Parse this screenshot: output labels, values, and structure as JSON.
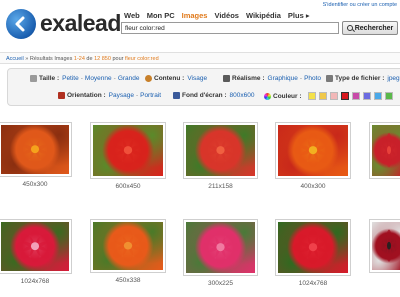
{
  "header": {
    "logo_text": "exalead",
    "nav": [
      {
        "label": "Web",
        "active": false
      },
      {
        "label": "Mon PC",
        "active": false
      },
      {
        "label": "Images",
        "active": true
      },
      {
        "label": "Vidéos",
        "active": false
      },
      {
        "label": "Wikipédia",
        "active": false
      },
      {
        "label": "Plus ▸",
        "active": false
      }
    ],
    "top_links": "S'identifier ou créer un compte",
    "search_value": "fleur color:red",
    "search_button": "Rechercher"
  },
  "breadcrumb": {
    "home": "Accueil",
    "sep": " » ",
    "results_label": "Résultats Images ",
    "range": "1-24",
    "of": " de ",
    "total": "12 850",
    "for": " pour ",
    "query": "fleur color:red"
  },
  "filters": {
    "taille": {
      "label": "Taille :",
      "options": [
        "Petite",
        "Moyenne",
        "Grande"
      ]
    },
    "contenu": {
      "label": "Contenu :",
      "options": [
        "Visage"
      ]
    },
    "realisme": {
      "label": "Réalisme :",
      "options": [
        "Graphique",
        "Photo"
      ]
    },
    "type": {
      "label": "Type de fichier :",
      "options": [
        "jpeg"
      ]
    },
    "orientation": {
      "label": "Orientation :",
      "options": [
        "Paysage",
        "Portrait"
      ]
    },
    "fond": {
      "label": "Fond d'écran :",
      "options": [
        "800x600"
      ]
    },
    "couleur": {
      "label": "Couleur :",
      "swatches": [
        "#f4e14a",
        "#f0c84a",
        "#f2b8b8",
        "#d8181e",
        "#c84aa8",
        "#6a6ae0",
        "#4aa8e8",
        "#5ab84a"
      ]
    }
  },
  "results": [
    {
      "size": "450x300",
      "colors": [
        "#e0581a",
        "#f5a21c",
        "#8a2e10"
      ]
    },
    {
      "size": "600x450",
      "colors": [
        "#d8231c",
        "#f0503a",
        "#5a8a2a"
      ]
    },
    {
      "size": "211x158",
      "colors": [
        "#d8352a",
        "#f06040",
        "#3f7a28"
      ]
    },
    {
      "size": "400x300",
      "colors": [
        "#e85a14",
        "#f2b020",
        "#c8281a"
      ]
    },
    {
      "size": "",
      "colors": [
        "#c8202a",
        "#e8403a",
        "#6a8a30"
      ]
    },
    {
      "size": "1024x768",
      "colors": [
        "#d81a3a",
        "#f2a0b8",
        "#3a6a20"
      ]
    },
    {
      "size": "450x338",
      "colors": [
        "#e85a1a",
        "#f09030",
        "#4a7a28"
      ]
    },
    {
      "size": "300x225",
      "colors": [
        "#e0306a",
        "#f07aa0",
        "#4a7a38"
      ]
    },
    {
      "size": "1024x768",
      "colors": [
        "#d81a2a",
        "#f0404a",
        "#2f6a20"
      ]
    },
    {
      "size": "",
      "colors": [
        "#a01020",
        "#2a2020",
        "#e0e0e0"
      ]
    }
  ]
}
